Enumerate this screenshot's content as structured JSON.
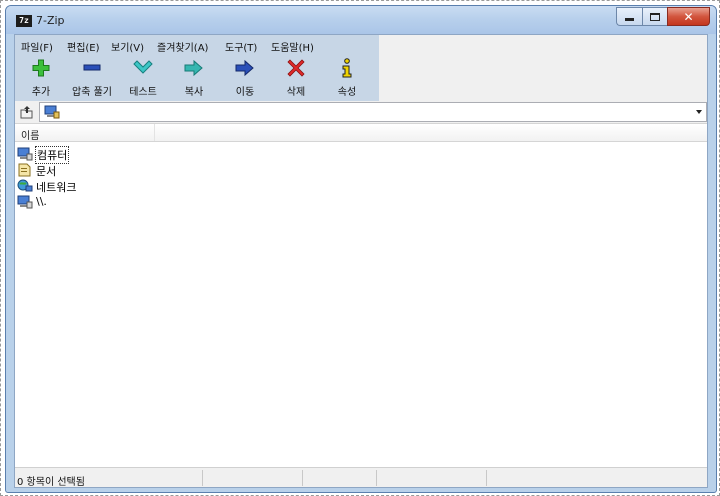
{
  "window": {
    "title": "7-Zip",
    "icon_text": "7z"
  },
  "menu": [
    {
      "label": "파일(F)"
    },
    {
      "label": "편집(E)"
    },
    {
      "label": "보기(V)"
    },
    {
      "label": "즐겨찾기(A)"
    },
    {
      "label": "도구(T)"
    },
    {
      "label": "도움말(H)"
    }
  ],
  "toolbar": [
    {
      "label": "추가",
      "icon": "plus-icon",
      "color": "#2fa52f"
    },
    {
      "label": "압축 풀기",
      "icon": "minus-icon",
      "color": "#1f3f9a"
    },
    {
      "label": "테스트",
      "icon": "check-icon",
      "color": "#2aa7a7"
    },
    {
      "label": "복사",
      "icon": "copy-arrow-icon",
      "color": "#2a9a9a"
    },
    {
      "label": "이동",
      "icon": "move-arrow-icon",
      "color": "#1f3f9a"
    },
    {
      "label": "삭제",
      "icon": "delete-x-icon",
      "color": "#d42020"
    },
    {
      "label": "속성",
      "icon": "info-icon",
      "color": "#2a2a8a"
    }
  ],
  "address": {
    "value": "",
    "icon": "computer-icon"
  },
  "list": {
    "columns": [
      {
        "label": "이름"
      }
    ],
    "items": [
      {
        "label": "컴퓨터",
        "icon": "computer-icon",
        "focused": true
      },
      {
        "label": "문서",
        "icon": "documents-folder-icon"
      },
      {
        "label": "네트워크",
        "icon": "network-icon"
      },
      {
        "label": "\\\\.",
        "icon": "device-icon"
      }
    ]
  },
  "status": {
    "selection": "0 항목이 선택됨"
  },
  "colors": {
    "accent": "#b9d1ea",
    "toolbar_band": "#c7d6e6",
    "close": "#c4361d"
  }
}
